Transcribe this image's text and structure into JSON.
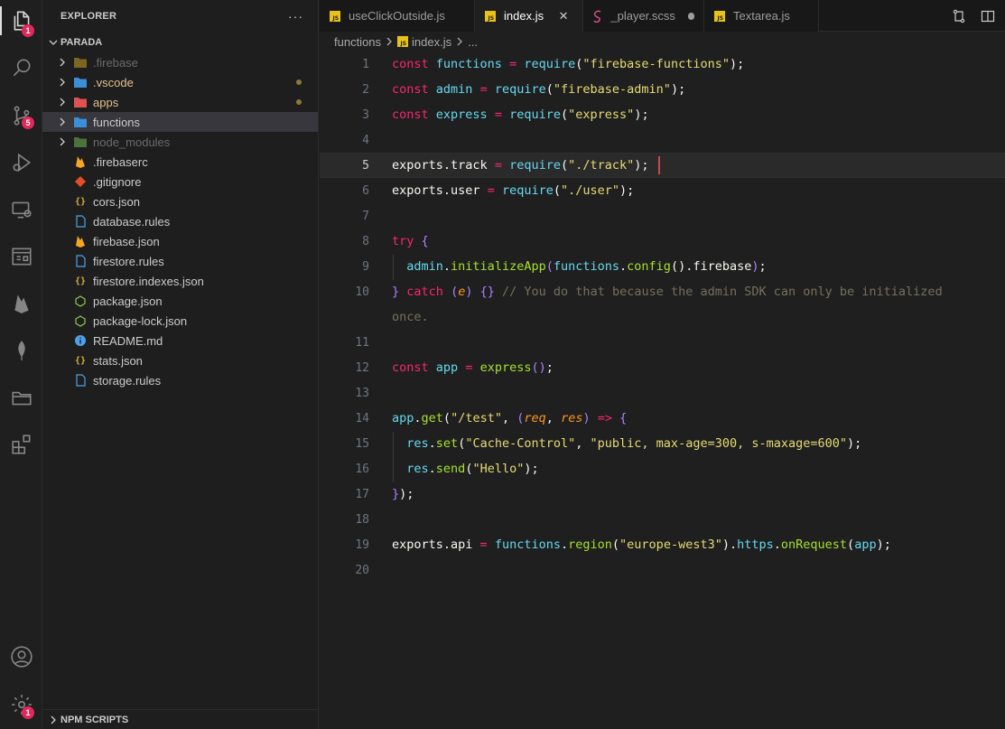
{
  "activity_bar": {
    "explorer_badge": "1",
    "scm_badge": "5",
    "settings_badge": "1",
    "icons": [
      "files-icon",
      "search-icon",
      "source-control-icon",
      "run-debug-icon",
      "remote-explorer-icon",
      "extensions-panel-icon",
      "firebase-icon",
      "mongodb-leaf-icon",
      "folder-icon",
      "extensions-icon",
      "account-icon",
      "settings-gear-icon"
    ]
  },
  "sidebar": {
    "title": "EXPLORER",
    "more": "···",
    "root": "PARADA",
    "items": [
      {
        "label": ".firebase",
        "type": "folder",
        "color": "dim",
        "modified": false
      },
      {
        "label": ".vscode",
        "type": "folder",
        "color": "yellow",
        "modified": true
      },
      {
        "label": "apps",
        "type": "folder",
        "color": "yellow",
        "modified": true
      },
      {
        "label": "functions",
        "type": "folder",
        "color": "normal",
        "modified": false,
        "selected": true
      },
      {
        "label": "node_modules",
        "type": "folder",
        "color": "dim",
        "modified": false
      },
      {
        "label": ".firebaserc",
        "type": "file",
        "icon": "firebase-icon"
      },
      {
        "label": ".gitignore",
        "type": "file",
        "icon": "git-icon"
      },
      {
        "label": "cors.json",
        "type": "file",
        "icon": "json-icon"
      },
      {
        "label": "database.rules",
        "type": "file",
        "icon": "file-icon"
      },
      {
        "label": "firebase.json",
        "type": "file",
        "icon": "firebase-icon"
      },
      {
        "label": "firestore.rules",
        "type": "file",
        "icon": "file-icon"
      },
      {
        "label": "firestore.indexes.json",
        "type": "file",
        "icon": "json-icon"
      },
      {
        "label": "package.json",
        "type": "file",
        "icon": "node-icon"
      },
      {
        "label": "package-lock.json",
        "type": "file",
        "icon": "node-icon"
      },
      {
        "label": "README.md",
        "type": "file",
        "icon": "info-icon"
      },
      {
        "label": "stats.json",
        "type": "file",
        "icon": "json-icon"
      },
      {
        "label": "storage.rules",
        "type": "file",
        "icon": "file-icon"
      }
    ],
    "npm_scripts": "NPM SCRIPTS"
  },
  "tabs": [
    {
      "label": "useClickOutside.js",
      "icon": "js-icon",
      "active": false,
      "state": "none"
    },
    {
      "label": "index.js",
      "icon": "js-icon",
      "active": true,
      "state": "close"
    },
    {
      "label": "_player.scss",
      "icon": "sass-icon",
      "active": false,
      "state": "modified"
    },
    {
      "label": "Textarea.js",
      "icon": "js-icon",
      "active": false,
      "state": "none"
    }
  ],
  "close_glyph": "✕",
  "breadcrumb": {
    "folder": "functions",
    "file": "index.js",
    "ellipsis": "..."
  },
  "editor": {
    "current_line": 5,
    "lines": [
      "1",
      "2",
      "3",
      "4",
      "5",
      "6",
      "7",
      "8",
      "9",
      "10",
      "11",
      "12",
      "13",
      "14",
      "15",
      "16",
      "17",
      "18",
      "19",
      "20"
    ]
  },
  "colors": {
    "accent_badge": "#e2285a",
    "keyword": "#f92672",
    "string": "#e6db74",
    "function": "#a6e22e",
    "identifier": "#66d9ef",
    "comment": "#75715e",
    "modified_dot": "#8a7a3a"
  }
}
